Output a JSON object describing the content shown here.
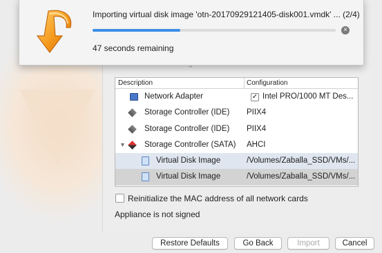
{
  "dialog": {
    "intro_text": "and double-click using the checkboxes below.",
    "table": {
      "headers": {
        "description": "Description",
        "configuration": "Configuration"
      },
      "rows": [
        {
          "description": "Network Adapter",
          "configuration": "Intel PRO/1000 MT Des...",
          "icon": "network-adapter-icon",
          "checked": true
        },
        {
          "description": "Storage Controller (IDE)",
          "configuration": "PIIX4",
          "icon": "storage-controller-icon"
        },
        {
          "description": "Storage Controller (IDE)",
          "configuration": "PIIX4",
          "icon": "storage-controller-icon"
        },
        {
          "description": "Storage Controller (SATA)",
          "configuration": "AHCI",
          "icon": "sata-controller-icon",
          "expanded": true
        },
        {
          "description": "Virtual Disk Image",
          "configuration": "/Volumes/Zaballa_SSD/VMs/...",
          "icon": "disk-image-icon"
        },
        {
          "description": "Virtual Disk Image",
          "configuration": "/Volumes/Zaballa_SSD/VMs/...",
          "icon": "disk-image-icon",
          "selected": true
        }
      ]
    },
    "reinit_label": "Reinitialize the MAC address of all network cards",
    "signed_status": "Appliance is not signed",
    "buttons": {
      "restore": "Restore Defaults",
      "back": "Go Back",
      "import": "Import",
      "cancel": "Cancel"
    }
  },
  "progress": {
    "title": "Importing virtual disk image 'otn-20170929121405-disk001.vmdk' ... (2/4)",
    "remaining": "47 seconds remaining",
    "percent": 36,
    "accent_color": "#3d8ee6"
  }
}
